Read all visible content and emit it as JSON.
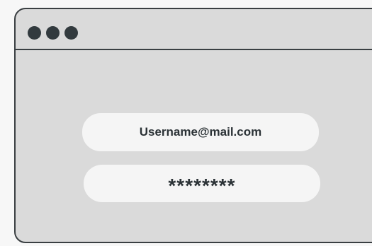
{
  "window": {
    "controls": [
      "window-dot",
      "window-dot",
      "window-dot"
    ]
  },
  "login": {
    "username_value": "Username@mail.com",
    "password_value": "********"
  },
  "colors": {
    "background": "#f7f7f7",
    "window_fill": "#dadada",
    "outline": "#3a3f42",
    "field_fill": "#f5f5f5",
    "text": "#2b3236"
  }
}
